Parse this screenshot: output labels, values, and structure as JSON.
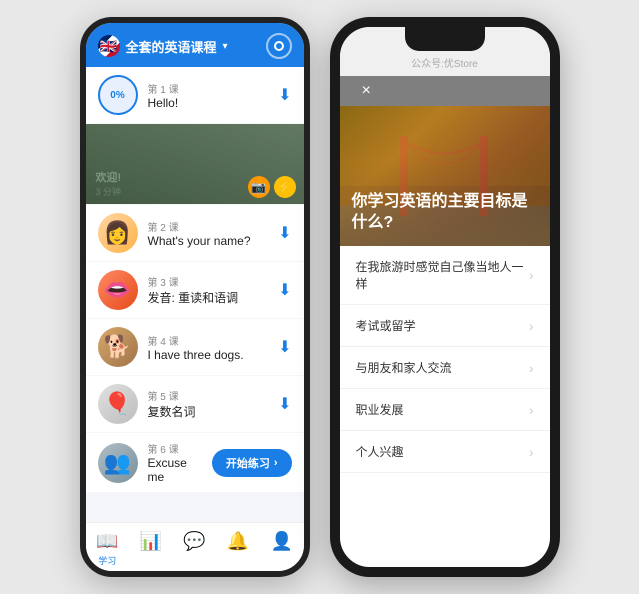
{
  "phone1": {
    "header": {
      "title": "全套的英语课程",
      "arrow": "▾",
      "flag": "🇬🇧"
    },
    "lessons": [
      {
        "id": "lesson-1",
        "num": "第 1 课",
        "name": "Hello!",
        "avatar_type": "percent",
        "avatar_text": "0%",
        "has_download": true
      },
      {
        "id": "lesson-2",
        "num": "第 2 课",
        "name": "What's your name?",
        "avatar_type": "woman",
        "avatar_emoji": "👩",
        "has_download": true
      },
      {
        "id": "lesson-3",
        "num": "第 3 课",
        "name": "发音: 重读和语调",
        "avatar_type": "mouth",
        "avatar_emoji": "👄",
        "has_download": true
      },
      {
        "id": "lesson-4",
        "num": "第 4 课",
        "name": "I have three dogs.",
        "avatar_type": "dog",
        "avatar_emoji": "🐕",
        "has_download": true
      },
      {
        "id": "lesson-5",
        "num": "第 5 课",
        "name": "复数名词",
        "avatar_type": "balloons",
        "avatar_emoji": "🎈",
        "has_download": true
      },
      {
        "id": "lesson-6",
        "num": "第 6 课",
        "name": "Excuse me",
        "avatar_type": "group",
        "avatar_emoji": "👥",
        "has_start_btn": true
      }
    ],
    "banner": {
      "label": "欢迎!",
      "sublabel": "3 分钟"
    },
    "start_btn_label": "开始练习",
    "footer": {
      "items": [
        {
          "id": "learn",
          "icon": "📖",
          "label": "学习",
          "active": true
        },
        {
          "id": "stats",
          "icon": "📊",
          "label": "",
          "active": false
        },
        {
          "id": "chat",
          "icon": "💬",
          "label": "",
          "active": false
        },
        {
          "id": "bell",
          "icon": "🔔",
          "label": "",
          "active": false
        },
        {
          "id": "profile",
          "icon": "👤",
          "label": "",
          "active": false
        }
      ]
    }
  },
  "phone2": {
    "watermark": "公众号:优Store",
    "close_label": "×",
    "hero_title": "你学习英语的主要目标是什么?",
    "options": [
      {
        "id": "opt-1",
        "text": "在我旅游时感觉自己像当地人一样"
      },
      {
        "id": "opt-2",
        "text": "考试或留学"
      },
      {
        "id": "opt-3",
        "text": "与朋友和家人交流"
      },
      {
        "id": "opt-4",
        "text": "职业发展"
      },
      {
        "id": "opt-5",
        "text": "个人兴趣"
      }
    ]
  }
}
